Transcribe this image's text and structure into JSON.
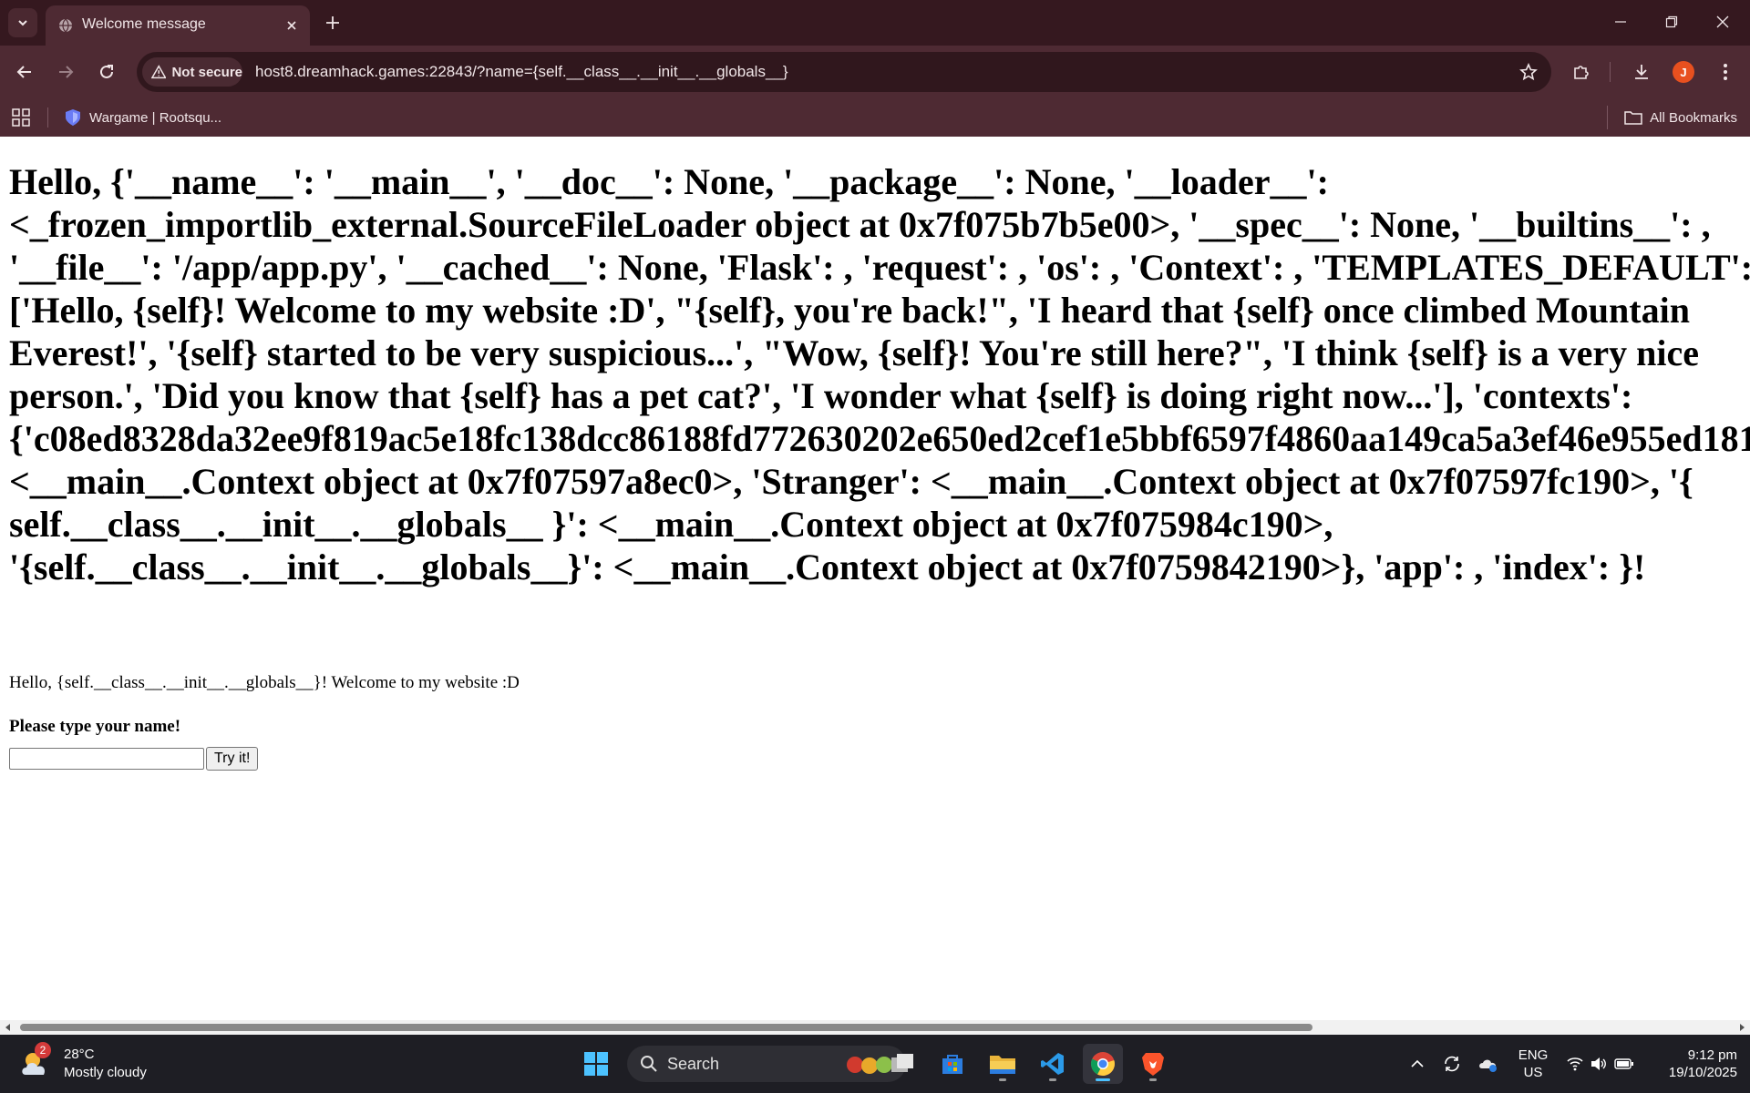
{
  "browser": {
    "tab_title": "Welcome message",
    "security_label": "Not secure",
    "url": "host8.dreamhack.games:22843/?name={self.__class__.__init__.__globals__}",
    "profile_initial": "J",
    "bookmarks": [
      {
        "label": "Wargame | Rootsqu..."
      }
    ],
    "all_bookmarks_label": "All Bookmarks"
  },
  "page": {
    "heading": "Hello, {'__name__': '__main__', '__doc__': None, '__package__': None, '__loader__': <_frozen_importlib_external.SourceFileLoader object at 0x7f075b7b5e00>, '__spec__': None, '__builtins__': , '__file__': '/app/app.py', '__cached__': None, 'Flask': , 'request': , 'os': , 'Context': , 'TEMPLATES_DEFAULT': ['Hello, {self}! Welcome to my website :D', \"{self}, you're back!\", 'I heard that {self} once climbed Mountain Everest!', '{self} started to be very suspicious...', \"Wow, {self}! You're still here?\", 'I think {self} is a very nice person.', 'Did you know that {self} has a pet cat?', 'I wonder what {self} is doing right now...'], 'contexts': {'c08ed8328da32ee9f819ac5e18fc138dcc86188fd772630202e650ed2cef1e5bbf6597f4860aa149ca5a3ef46e955ed181 <__main__.Context object at 0x7f07597a8ec0>, 'Stranger': <__main__.Context object at 0x7f07597fc190>, '{ self.__class__.__init__.__globals__ }': <__main__.Context object at 0x7f075984c190>, '{self.__class__.__init__.__globals__}': <__main__.Context object at 0x7f0759842190>}, 'app': , 'index': }!",
    "welcome_line": "Hello, {self.__class__.__init__.__globals__}! Welcome to my website :D",
    "prompt": "Please type your name!",
    "name_input_value": "",
    "submit_label": "Try it!"
  },
  "taskbar": {
    "weather_badge": "2",
    "temperature": "28°C",
    "condition": "Mostly cloudy",
    "search_label": "Search",
    "language": "ENG",
    "region": "US",
    "time": "9:12 pm",
    "date": "19/10/2025"
  },
  "colors": {
    "tabstrip": "#35181f",
    "toolbar": "#4e2a33",
    "avatar": "#e8501f",
    "taskbar": "#1e1e24"
  }
}
